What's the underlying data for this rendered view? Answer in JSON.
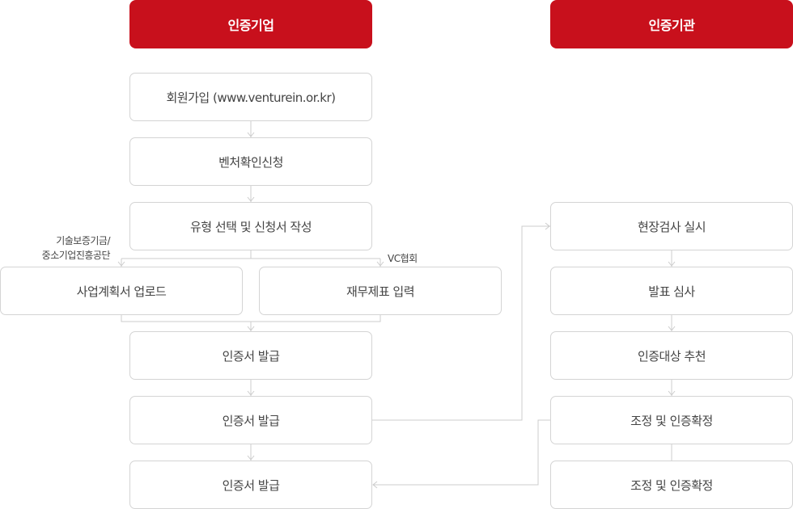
{
  "headers": {
    "company": "인증기업",
    "agency": "인증기관"
  },
  "company_steps": {
    "signup": "회원가입 (www.venturein.or.kr)",
    "apply": "벤처확인신청",
    "select_type": "유형 선택 및 신청서 작성",
    "upload_plan": "사업계획서 업로드",
    "financials": "재무제표 입력",
    "issue_1": "인증서 발급",
    "issue_2": "인증서 발급",
    "issue_3": "인증서 발급"
  },
  "notes": {
    "left_line1": "기술보증기금/",
    "left_line2": "중소기업진흥공단",
    "right": "VC협회"
  },
  "agency_steps": {
    "inspection": "현장검사 실시",
    "presentation": "발표 심사",
    "recommend": "인증대상 추천",
    "adjust_1": "조정 및 인증확정",
    "adjust_2": "조정 및 인증확정"
  }
}
